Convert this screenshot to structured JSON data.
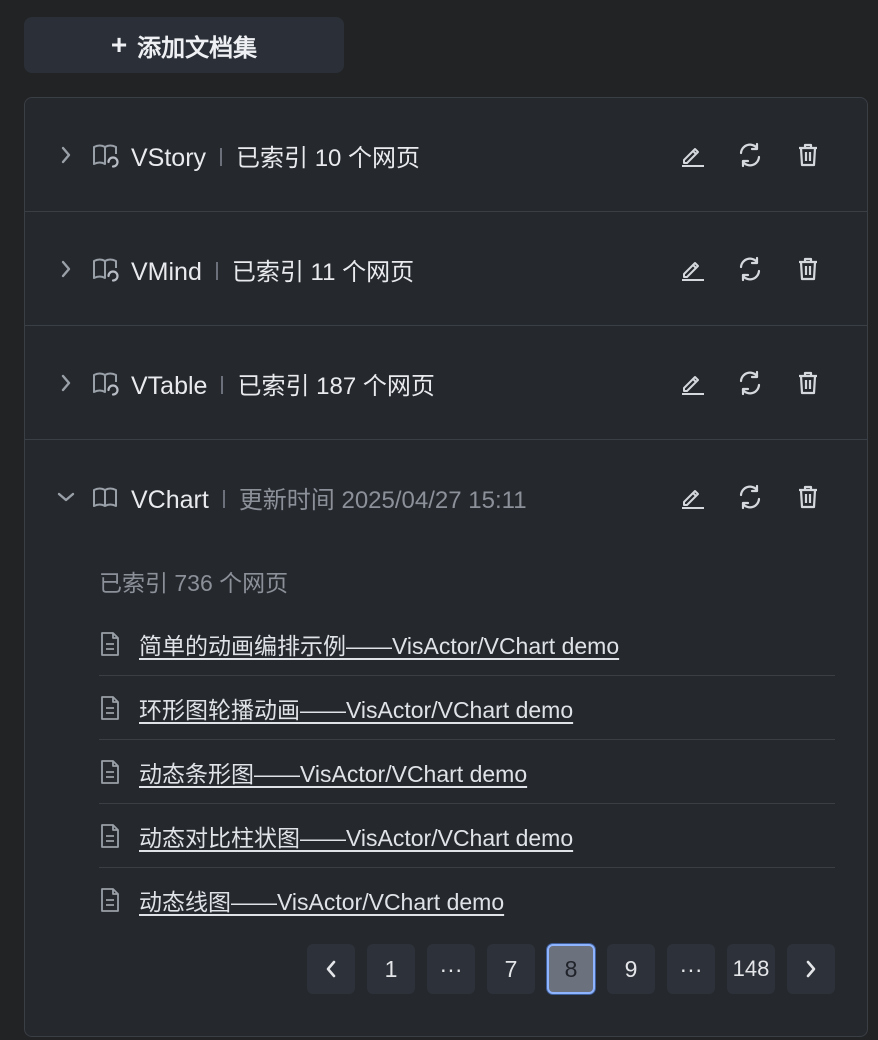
{
  "add_button": {
    "icon": "plus-icon",
    "label": "添加文档集"
  },
  "collections": [
    {
      "name": "VStory",
      "meta": "已索引 10 个网页",
      "expanded": false
    },
    {
      "name": "VMind",
      "meta": "已索引 11 个网页",
      "expanded": false
    },
    {
      "name": "VTable",
      "meta": "已索引 187 个网页",
      "expanded": false
    },
    {
      "name": "VChart",
      "meta": "更新时间 2025/04/27 15:11",
      "expanded": true,
      "indexed_count": "已索引 736 个网页",
      "documents": [
        "简单的动画编排示例——VisActor/VChart demo",
        "环形图轮播动画——VisActor/VChart demo",
        "动态条形图——VisActor/VChart demo",
        "动态对比柱状图——VisActor/VChart demo",
        "动态线图——VisActor/VChart demo"
      ]
    }
  ],
  "pagination": {
    "prev_icon": "chevron-left-icon",
    "pages": [
      "1",
      "···",
      "7",
      "8",
      "9",
      "···",
      "148"
    ],
    "current": "8",
    "next_icon": "chevron-right-icon"
  },
  "colors": {
    "current_page_border": "#8fb4ff",
    "background": "#222325"
  }
}
